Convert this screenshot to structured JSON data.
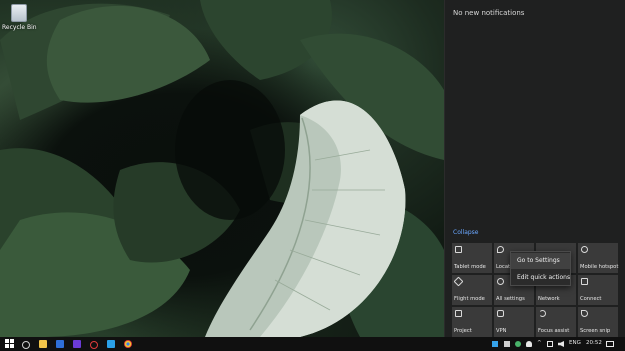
{
  "desktop": {
    "recycle_bin_label": "Recycle Bin"
  },
  "action_center": {
    "empty_message": "No new notifications",
    "collapse_label": "Collapse",
    "tiles": [
      {
        "label": "Tablet mode",
        "icon": "tablet-icon"
      },
      {
        "label": "Location",
        "icon": "location-icon"
      },
      {
        "label": "",
        "icon": "blank-icon"
      },
      {
        "label": "Mobile hotspot",
        "icon": "hotspot-icon"
      },
      {
        "label": "Flight mode",
        "icon": "airplane-icon"
      },
      {
        "label": "All settings",
        "icon": "gear-icon"
      },
      {
        "label": "Network",
        "icon": "network-icon"
      },
      {
        "label": "Connect",
        "icon": "connect-icon"
      },
      {
        "label": "Project",
        "icon": "project-icon"
      },
      {
        "label": "VPN",
        "icon": "vpn-icon"
      },
      {
        "label": "Focus assist",
        "icon": "moon-icon"
      },
      {
        "label": "Screen snip",
        "icon": "snip-icon"
      }
    ]
  },
  "context_menu": {
    "items": [
      "Go to Settings",
      "Edit quick actions"
    ]
  },
  "taskbar": {
    "language": "ENG",
    "time": "20:52"
  },
  "colors": {
    "accent_link": "#6aa7ff",
    "panel_bg": "#1f2020",
    "tile_bg": "#3a3a3a"
  }
}
